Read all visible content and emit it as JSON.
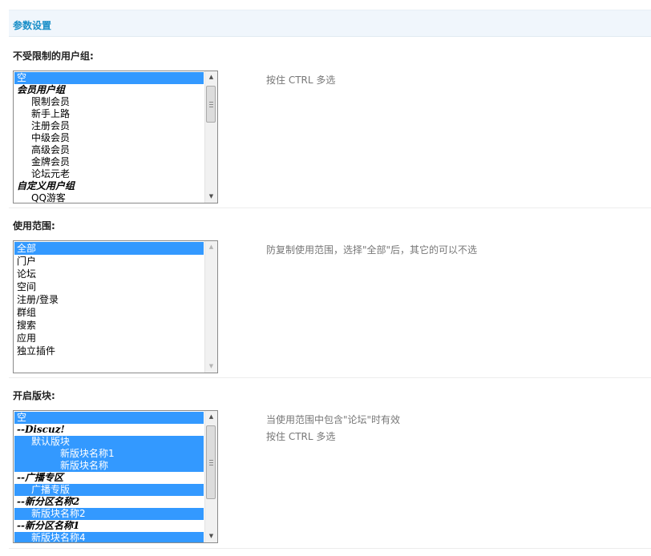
{
  "section": {
    "title": "参数设置"
  },
  "user_groups": {
    "label": "不受限制的用户组:",
    "tip": "按住 CTRL 多选",
    "options": [
      {
        "text": "空",
        "level": 0,
        "group": false,
        "selected": true
      },
      {
        "text": "会员用户组",
        "level": 0,
        "group": true,
        "selected": false
      },
      {
        "text": "限制会员",
        "level": 1,
        "group": false,
        "selected": false
      },
      {
        "text": "新手上路",
        "level": 1,
        "group": false,
        "selected": false
      },
      {
        "text": "注册会员",
        "level": 1,
        "group": false,
        "selected": false
      },
      {
        "text": "中级会员",
        "level": 1,
        "group": false,
        "selected": false
      },
      {
        "text": "高级会员",
        "level": 1,
        "group": false,
        "selected": false
      },
      {
        "text": "金牌会员",
        "level": 1,
        "group": false,
        "selected": false
      },
      {
        "text": "论坛元老",
        "level": 1,
        "group": false,
        "selected": false
      },
      {
        "text": "自定义用户组",
        "level": 0,
        "group": true,
        "selected": false
      },
      {
        "text": "QQ游客",
        "level": 1,
        "group": false,
        "selected": false
      }
    ]
  },
  "scope": {
    "label": "使用范围:",
    "tip": "防复制使用范围，选择\"全部\"后，其它的可以不选",
    "options": [
      {
        "text": "全部",
        "level": 0,
        "group": false,
        "selected": true
      },
      {
        "text": "门户",
        "level": 0,
        "group": false,
        "selected": false
      },
      {
        "text": "论坛",
        "level": 0,
        "group": false,
        "selected": false
      },
      {
        "text": "空间",
        "level": 0,
        "group": false,
        "selected": false
      },
      {
        "text": "注册/登录",
        "level": 0,
        "group": false,
        "selected": false
      },
      {
        "text": "群组",
        "level": 0,
        "group": false,
        "selected": false
      },
      {
        "text": "搜索",
        "level": 0,
        "group": false,
        "selected": false
      },
      {
        "text": "应用",
        "level": 0,
        "group": false,
        "selected": false
      },
      {
        "text": "独立插件",
        "level": 0,
        "group": false,
        "selected": false
      }
    ]
  },
  "forums": {
    "label": "开启版块:",
    "tip_line1": "当使用范围中包含\"论坛\"时有效",
    "tip_line2": "按住 CTRL 多选",
    "options": [
      {
        "text": "空",
        "level": 0,
        "group": false,
        "selected": true
      },
      {
        "text": "--Discuz!",
        "level": 0,
        "group": true,
        "selected": false
      },
      {
        "text": "默认版块",
        "level": 1,
        "group": false,
        "selected": true
      },
      {
        "text": "新版块名称1",
        "level": 2,
        "group": false,
        "selected": true
      },
      {
        "text": "新版块名称",
        "level": 2,
        "group": false,
        "selected": true
      },
      {
        "text": "--广播专区",
        "level": 0,
        "group": true,
        "selected": false
      },
      {
        "text": "广播专版",
        "level": 1,
        "group": false,
        "selected": true
      },
      {
        "text": "--新分区名称2",
        "level": 0,
        "group": true,
        "selected": false
      },
      {
        "text": "新版块名称2",
        "level": 1,
        "group": false,
        "selected": true
      },
      {
        "text": "--新分区名称1",
        "level": 0,
        "group": true,
        "selected": false
      },
      {
        "text": "新版块名称4",
        "level": 1,
        "group": false,
        "selected": true
      }
    ]
  },
  "icons": {
    "scroll_up": "▲",
    "scroll_down": "▼"
  }
}
